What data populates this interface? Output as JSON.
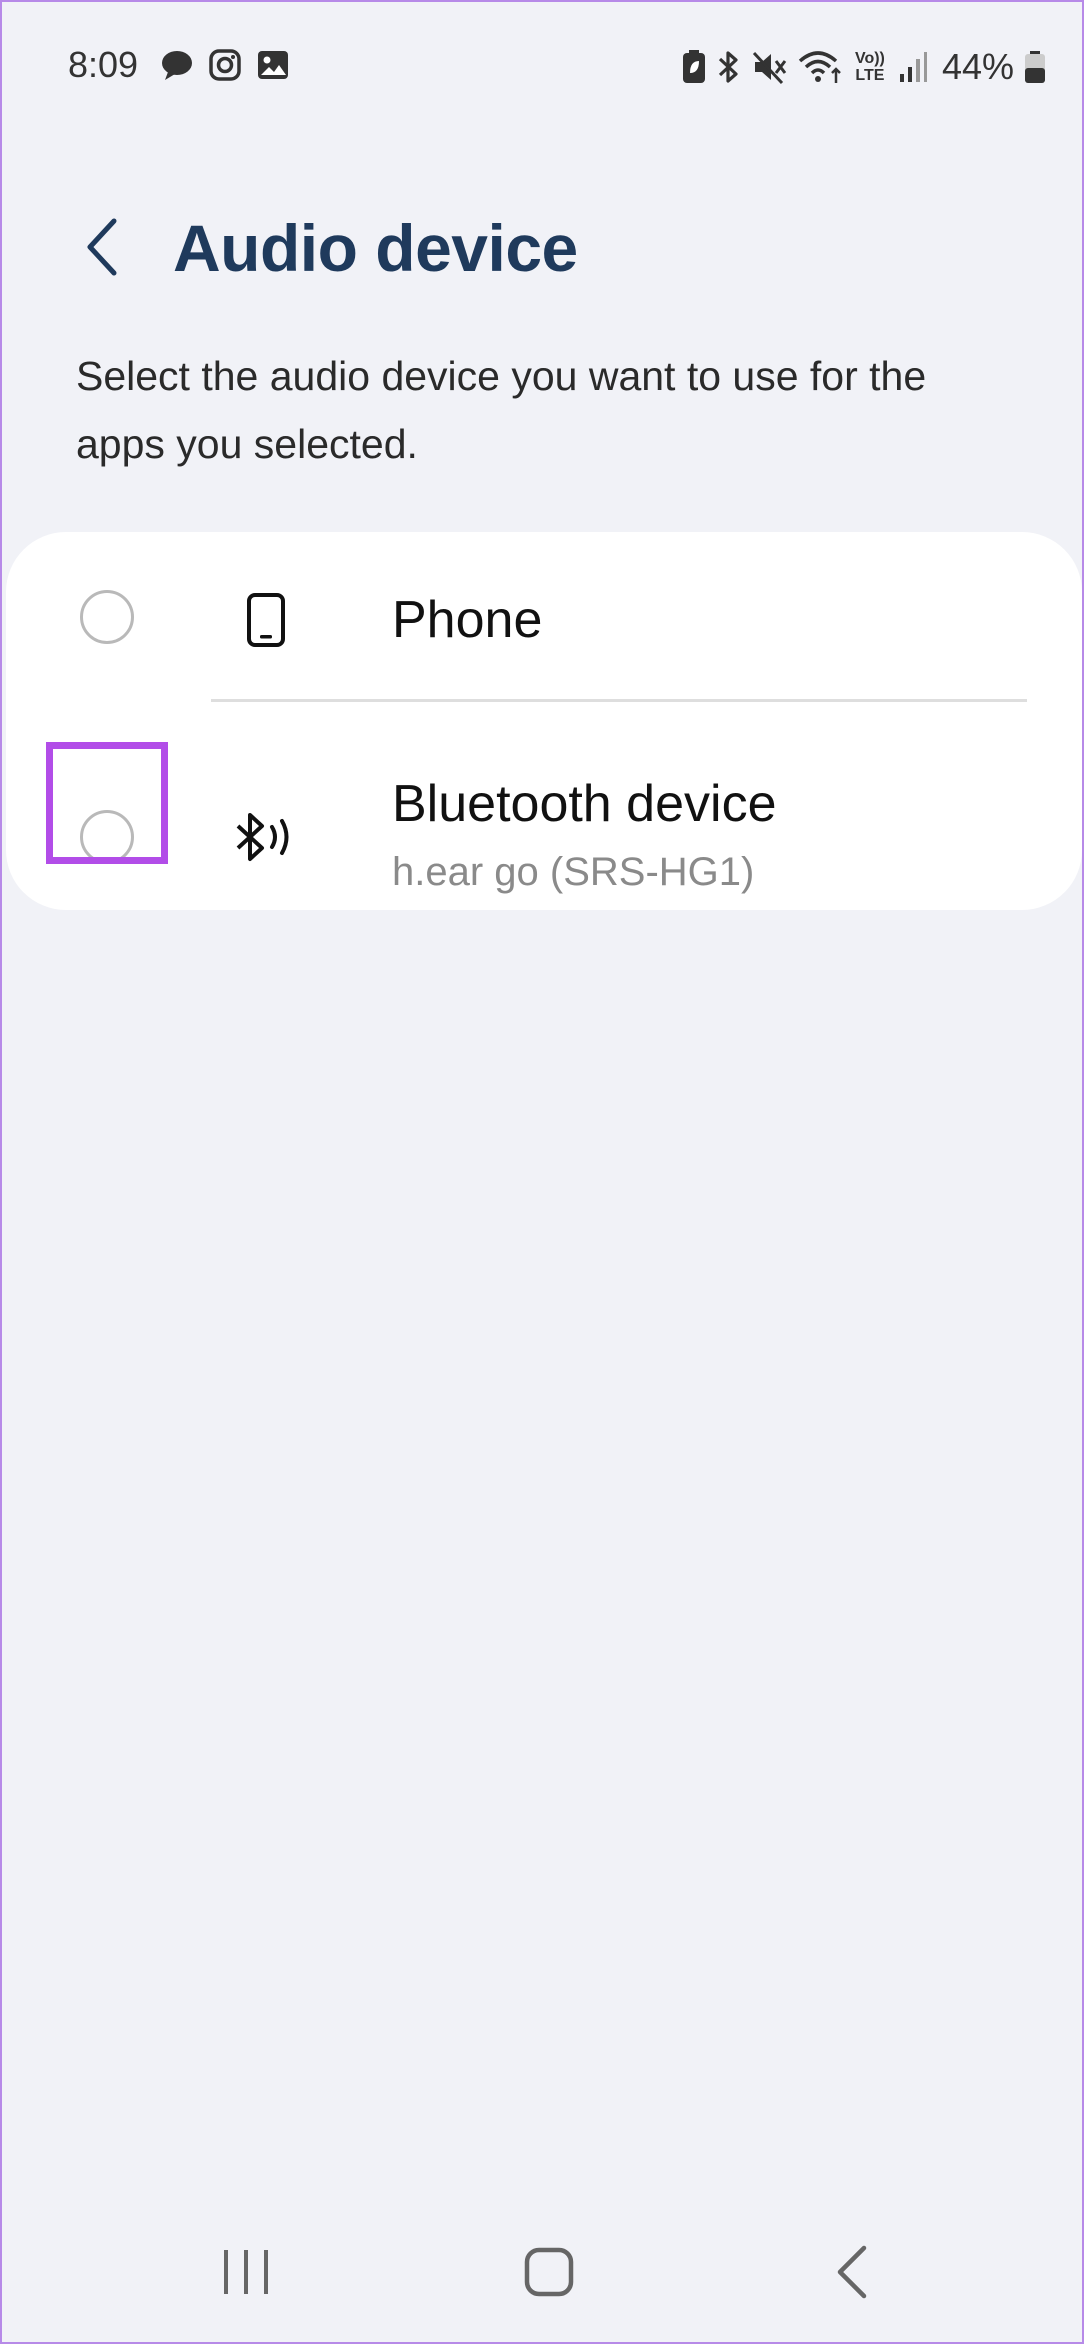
{
  "status_bar": {
    "time": "8:09",
    "battery": "44%",
    "volte_top": "Vo))",
    "volte_bottom": "LTE",
    "left_icons": [
      "chat-icon",
      "instagram-icon",
      "gallery-icon"
    ],
    "right_icons": [
      "battery-saver-icon",
      "bluetooth-icon",
      "mute-icon",
      "wifi-icon",
      "volte-icon",
      "signal-icon",
      "battery-icon"
    ]
  },
  "header": {
    "title": "Audio device",
    "back_icon": "chevron-left-icon"
  },
  "description": "Select the audio device you want to use for the apps you selected.",
  "devices": [
    {
      "label": "Phone",
      "icon": "phone-icon",
      "selected": false
    },
    {
      "label": "Bluetooth device",
      "subtitle": "h.ear go (SRS-HG1)",
      "icon": "bluetooth-audio-icon",
      "selected": false,
      "highlighted": true
    }
  ],
  "nav_bar": {
    "buttons": [
      "recents-icon",
      "home-icon",
      "back-icon"
    ]
  },
  "colors": {
    "background": "#f1f2f7",
    "title": "#1f3a5c",
    "highlight": "#b24de8",
    "card": "#ffffff"
  }
}
